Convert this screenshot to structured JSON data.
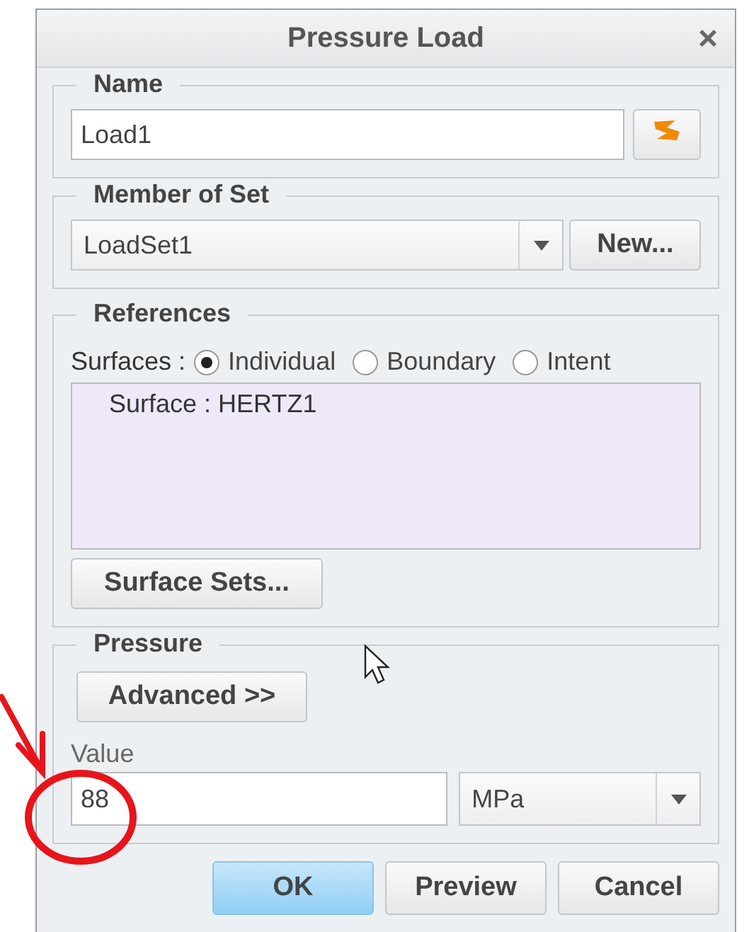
{
  "window": {
    "title": "Pressure Load",
    "close": "×"
  },
  "name_group": {
    "label": "Name",
    "value": "Load1"
  },
  "member_group": {
    "label": "Member of Set",
    "value": "LoadSet1",
    "button": "New..."
  },
  "references": {
    "label": "References",
    "surfaces_label": "Surfaces :",
    "options": [
      {
        "label": "Individual",
        "selected": true
      },
      {
        "label": "Boundary",
        "selected": false
      },
      {
        "label": "Intent",
        "selected": false
      }
    ],
    "items": [
      "Surface : HERTZ1"
    ],
    "button": "Surface Sets..."
  },
  "pressure": {
    "label": "Pressure",
    "button": "Advanced >>",
    "value_label": "Value",
    "value": "88",
    "unit": "MPa"
  },
  "buttons": [
    {
      "label": "OK",
      "kind": "primary"
    },
    {
      "label": "Preview",
      "kind": "normal"
    },
    {
      "label": "Cancel",
      "kind": "normal"
    }
  ]
}
